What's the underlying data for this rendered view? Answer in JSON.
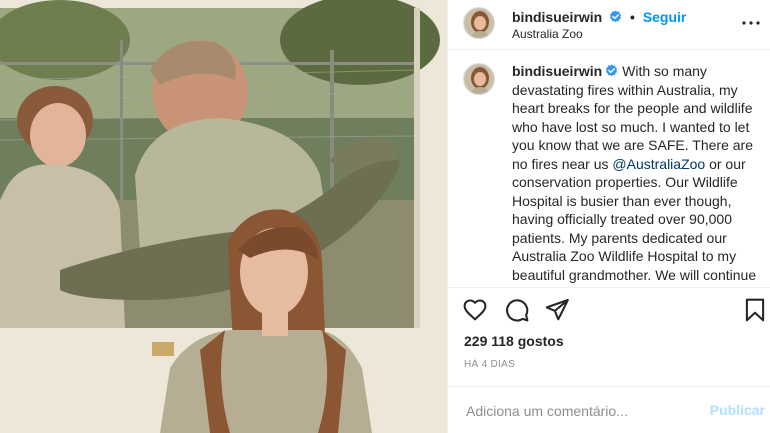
{
  "post": {
    "username": "bindisueirwin",
    "follow_label": "Seguir",
    "dot": "•",
    "location": "Australia Zoo",
    "caption_before": "With so many devastating fires within Australia, my heart breaks for the people and wildlife who have lost so much. I wanted to let you know that we are SAFE. There are no fires near us ",
    "caption_mention": "@AustraliaZoo",
    "caption_after": " or our conservation properties. Our Wildlife Hospital is busier than ever though, having officially treated over 90,000 patients. My parents dedicated our Australia Zoo Wildlife Hospital to my beautiful grandmother. We will continue to keep her legacy alive for Wildlife Warriors and all",
    "likes": "229 118 gostos",
    "time": "HÁ 4 DIAS",
    "comment_placeholder": "Adiciona um comentário...",
    "publish_label": "Publicar"
  },
  "icons": {
    "header": [
      "verified-badge-icon",
      "more-options-icon"
    ],
    "actions": [
      "heart-icon",
      "comment-icon",
      "share-icon",
      "save-icon"
    ]
  },
  "colors": {
    "accent": "#0095f6",
    "mention": "#00376b",
    "publish_disabled": "#b2dffc",
    "muted": "#8e8e8e",
    "text": "#262626",
    "divider": "#efefef"
  }
}
